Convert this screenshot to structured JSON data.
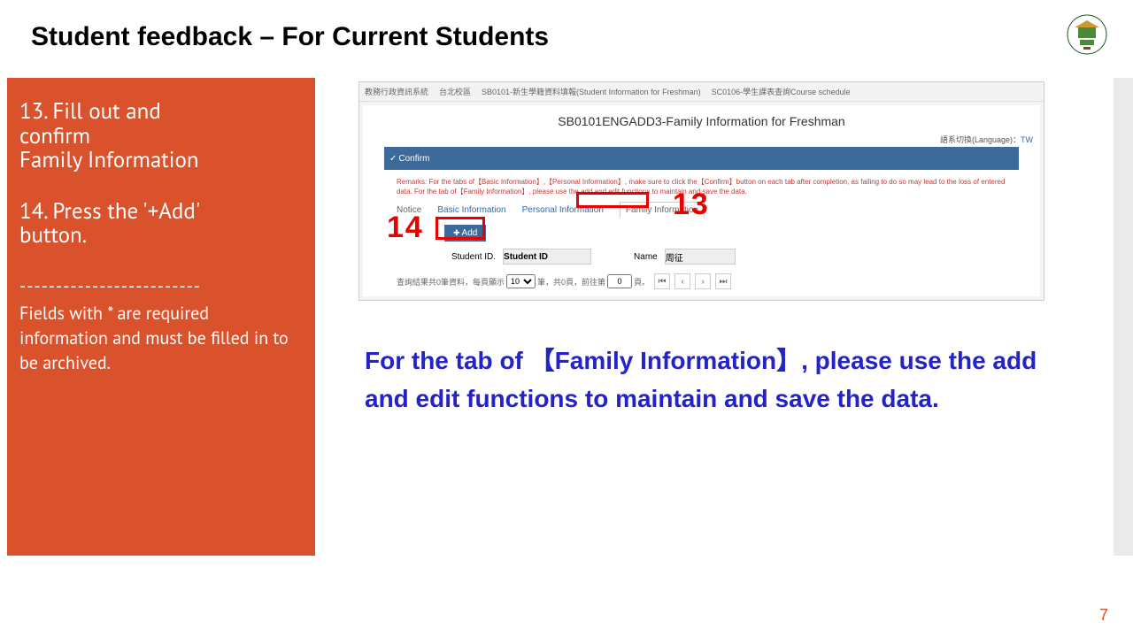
{
  "title": "Student feedback – For Current Students",
  "sidebar": {
    "step13_l1": "13. Fill out and",
    "step13_l2": "confirm",
    "step13_l3": "Family Information",
    "step14_l1": "14. Press the '+Add'",
    "step14_l2": "button.",
    "divider": "-------------------------",
    "note": "Fields with * are required information and must be filled in to be archived."
  },
  "screenshot": {
    "topnav": {
      "a": "教務行政資訊系統",
      "b": "台北校區",
      "c": "SB0101-新生學籍資料填報(Student Information for Freshman)",
      "d": "SC0106-學生課表查詢Course schedule"
    },
    "page_title": "SB0101ENGADD3-Family Information for Freshman",
    "lang_label": "語系切換(Language)：",
    "lang_link": "TW",
    "confirm_label": "Confirm",
    "remarks": "Remarks: For the tabs of【Basic Information】,【Personal Information】, make sure to click the【Confirm】button on each tab after completion, as failing to do so may lead to the loss of entered data. For the tab of【Family Information】, please use the add and edit functions to maintain and save the data.",
    "tabs": {
      "notice": "Notice",
      "basic": "Basic Information",
      "personal": "Personal Information",
      "family": "Family Information"
    },
    "add_label": "Add",
    "labels": {
      "sid": "Student ID.",
      "name": "Name"
    },
    "fields": {
      "sid": "Student ID",
      "name": "周征"
    },
    "pager": {
      "pre": "查詢結果共0筆資料，每頁顯示",
      "per": "10",
      "mid": "筆，共0頁，前往第",
      "cur": "0",
      "post": "頁。",
      "first": "⏮",
      "prev": "‹",
      "next": "›",
      "last": "⏭"
    }
  },
  "callouts": {
    "n13": "13",
    "n14": "14"
  },
  "blue_note": "For the tab of 【Family Information】, please use the add and edit functions to maintain and save the data.",
  "page_number": "7"
}
